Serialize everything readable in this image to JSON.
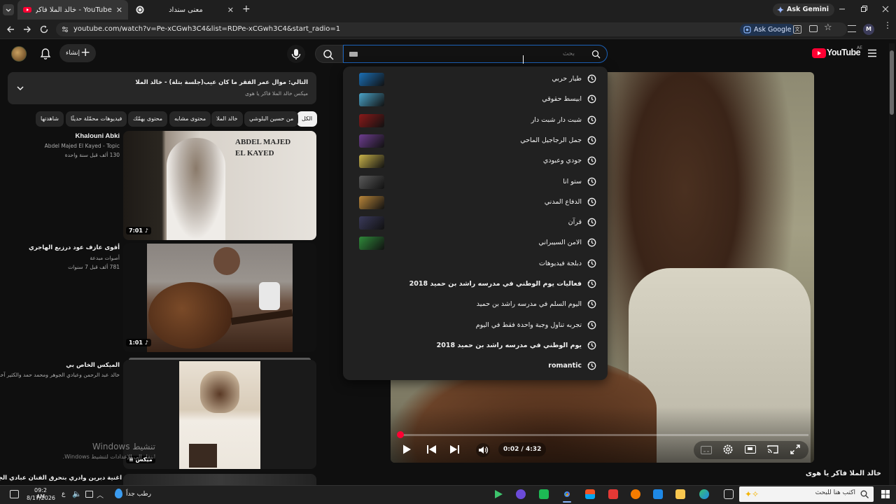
{
  "browser": {
    "tabs": [
      {
        "title": "YouTube - خالد الملا فاكر يا هوى"
      },
      {
        "title": "معنى سنداد"
      }
    ],
    "ask_gemini": "Ask Gemini",
    "url": "youtube.com/watch?v=Pe-xCGwh3C4&list=RDPe-xCGwh3C4&start_radio=1",
    "ask_google": "Ask Google",
    "profile_letter": "M"
  },
  "youtube": {
    "logo_text": "YouTube",
    "region": "AE",
    "search_placeholder": "بحث",
    "search_value": "",
    "create_label": "إنشاء"
  },
  "playlist": {
    "title": "التالي: موال عمر الفقر ما كان عيب(جلسة بتلة) - خالد الملا",
    "subtitle": "ميكس خالد الملا فاكر يا هوى"
  },
  "chips": [
    {
      "label": "الكل",
      "selected": true
    },
    {
      "label": "من حسين البلوشي"
    },
    {
      "label": "خالد الملا"
    },
    {
      "label": "محتوى مشابه"
    },
    {
      "label": "محتوى يهمّك"
    },
    {
      "label": "فيديوهات محمّلة حديثًا"
    },
    {
      "label": "شاهدتها"
    }
  ],
  "recommendations": [
    {
      "title": "Khalouni Abki",
      "channel": "Abdel Majed El Kayed - Topic",
      "meta": "130 ألف  قبل سنة واحدة",
      "duration": "7:01",
      "thumb_text": "ABDEL MAJED\nEL KAYED"
    },
    {
      "title": "أقوى عازف عود درزيع الهاجري",
      "channel": "أصوات مبدعة",
      "meta": "781 ألف  قبل 7 سنوات",
      "duration": "1:01"
    },
    {
      "title": "الميكس الخاص بي",
      "channel": "خالد عبد الرحمن وعبادي الجوهر ومحمد حمد والكثير آخرون",
      "meta": "",
      "duration": "ميكس"
    },
    {
      "title": "اغنية دبرين وادري بتحرق الفنان عبادي الجوهر",
      "channel": "",
      "meta": "",
      "duration": ""
    }
  ],
  "suggestions": [
    {
      "text": "طيار حربي",
      "thumb": "#1b6fb5"
    },
    {
      "text": "ابيسط حقوقي",
      "thumb": "#4aa3c7"
    },
    {
      "text": "شبت دار شبت دار",
      "thumb": "#8a1a1a"
    },
    {
      "text": "جمل الرجاجيل الماحي",
      "thumb": "#6d3d8f"
    },
    {
      "text": "جودي وعبودي",
      "thumb": "#c7b24a"
    },
    {
      "text": "ستو انا",
      "thumb": "#5a5a5a"
    },
    {
      "text": "الدفاع المدني",
      "thumb": "#b8863a"
    },
    {
      "text": "قرآن",
      "thumb": "#3a3a5a"
    },
    {
      "text": "الامن السيبراني",
      "thumb": "#2f8a3a"
    },
    {
      "text": "دبلجة فيديوهات"
    },
    {
      "text": "فعاليات يوم الوطني في مدرسه راشد بن حميد 2018"
    },
    {
      "text": "اليوم السلم في مدرسه راشد بن حميد"
    },
    {
      "text": "تجربه تناول وجبة واحدة فقط في اليوم"
    },
    {
      "text": "يوم الوطني في مدرسه راشد بن حميد 2018"
    },
    {
      "text": "romantic"
    }
  ],
  "player": {
    "time": "0:02 / 4:32",
    "progress": 0.007,
    "video_title": "خالد الملا فاكر يا هوى"
  },
  "watermark": {
    "line1": "تنشيط Windows",
    "line2": "انتقل إلى الإعدادات لتنشيط Windows."
  },
  "taskbar": {
    "time": "09:2 AM",
    "date": "8/17/2026",
    "lang": "ع",
    "weather": "رطب جداً",
    "search_placeholder": "اكتب هنا للبحث"
  },
  "colors": {
    "accent_red": "#ff0033",
    "bg": "#0f0f0f",
    "panel": "#212121"
  }
}
